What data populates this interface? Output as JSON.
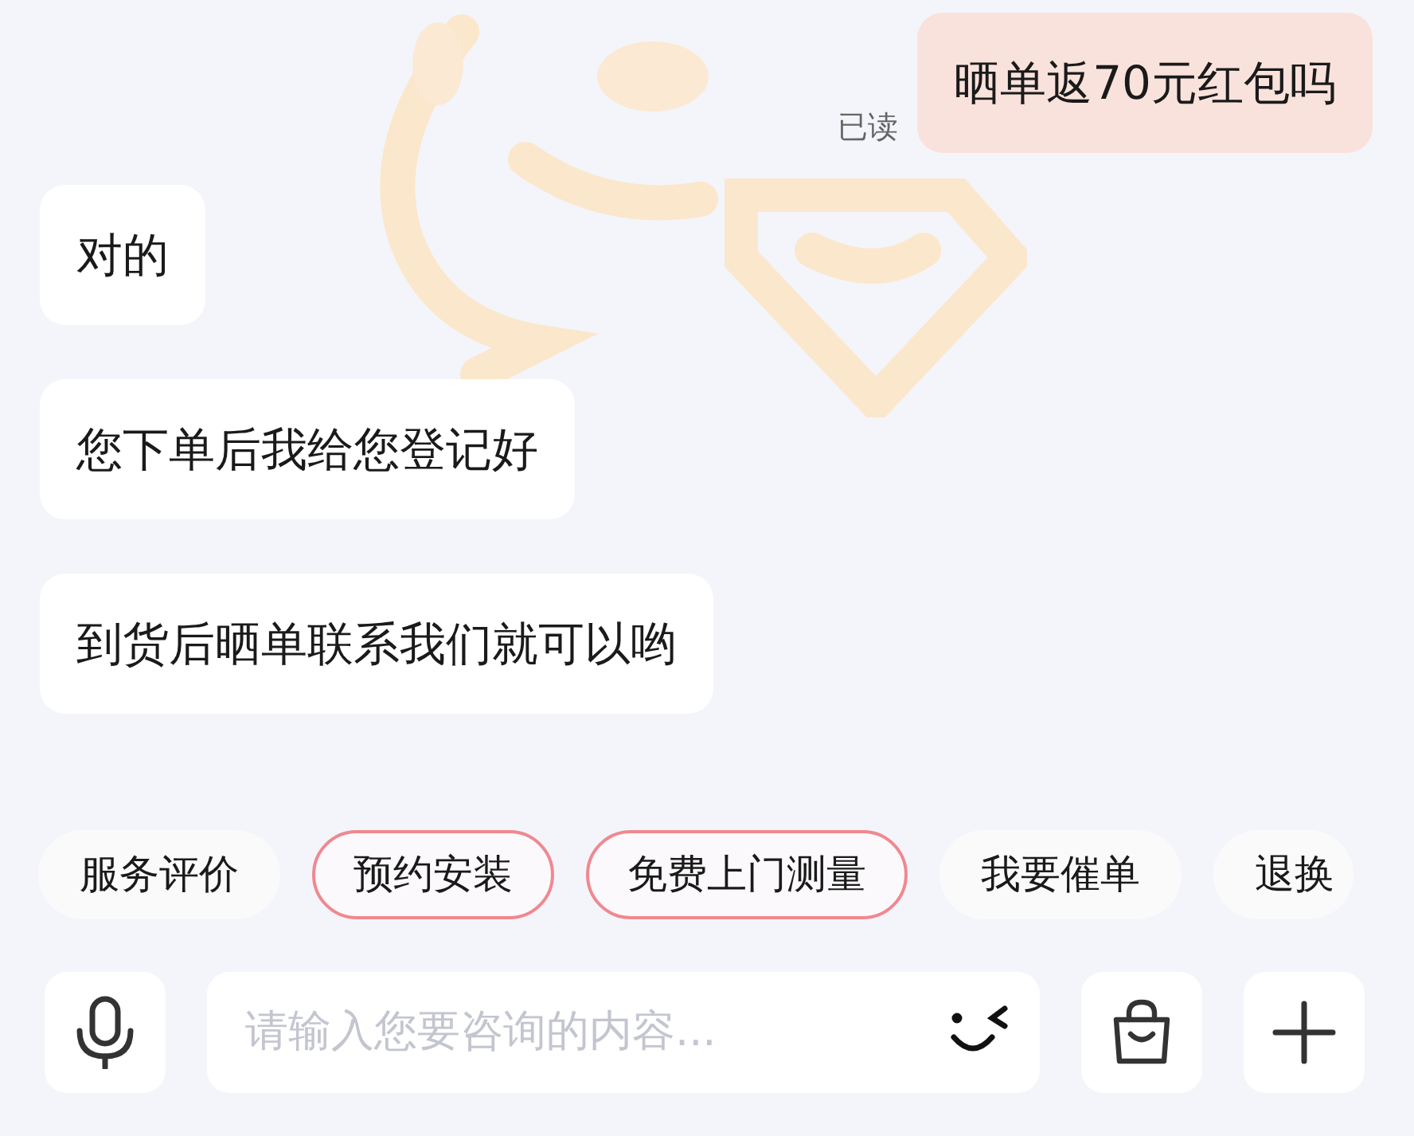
{
  "messages": [
    {
      "kind": "sent",
      "text": "晒单返70元红包吗",
      "status": "已读"
    },
    {
      "kind": "received",
      "text": "对的"
    },
    {
      "kind": "received",
      "text": "您下单后我给您登记好"
    },
    {
      "kind": "received",
      "text": "到货后晒单联系我们就可以哟"
    }
  ],
  "quick_replies": [
    {
      "label": "服务评价",
      "highlighted": false
    },
    {
      "label": "预约安装",
      "highlighted": true
    },
    {
      "label": "免费上门测量",
      "highlighted": true
    },
    {
      "label": "我要催单",
      "highlighted": false
    },
    {
      "label": "退换",
      "highlighted": false
    }
  ],
  "input": {
    "placeholder": "请输入您要咨询的内容..."
  }
}
